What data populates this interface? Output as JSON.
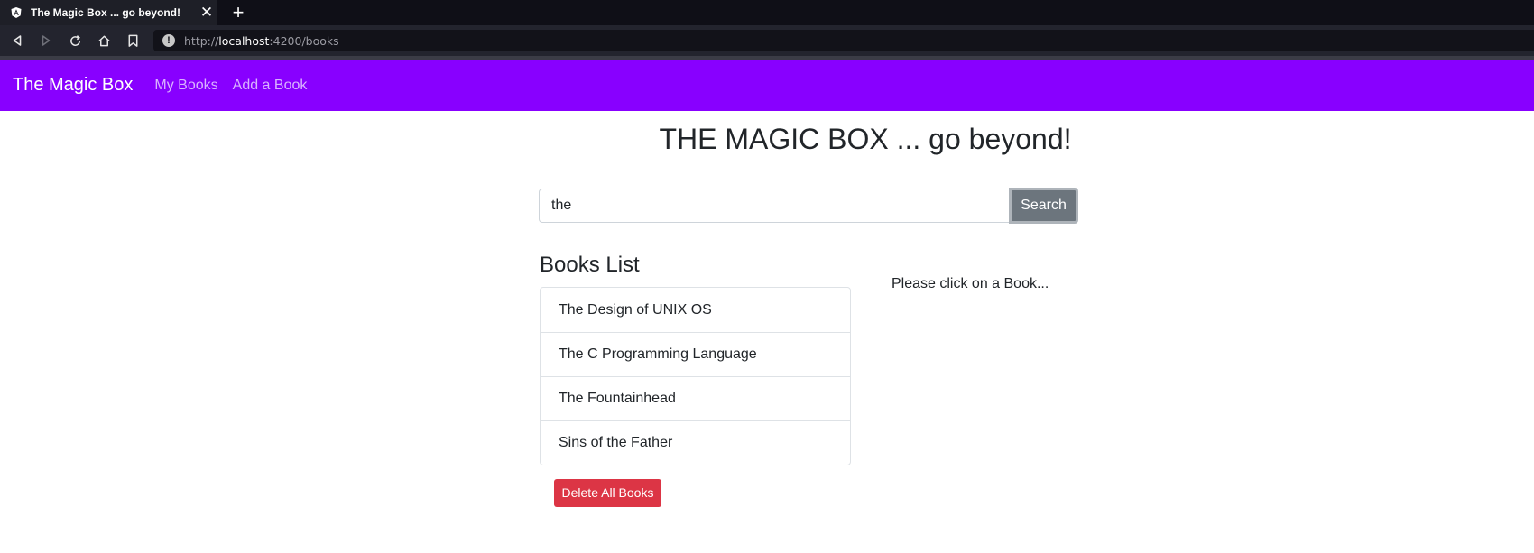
{
  "browser": {
    "tab_title": "The Magic Box ... go beyond!",
    "close_glyph": "✕",
    "new_tab_glyph": "+",
    "url_scheme": "http://",
    "url_host": "localhost",
    "url_path": ":4200/books",
    "info_glyph": "!",
    "icons": [
      "angular-favicon-icon",
      "back-icon",
      "forward-icon",
      "reload-icon",
      "home-icon",
      "bookmark-icon",
      "site-info-icon"
    ]
  },
  "app_nav": {
    "brand": "The Magic Box",
    "links": [
      "My Books",
      "Add a Book"
    ],
    "background": "#8800ff"
  },
  "main": {
    "heading": "THE MAGIC BOX ... go beyond!",
    "search": {
      "value": "the",
      "button_label": "Search"
    },
    "books_list": {
      "heading": "Books List",
      "items": [
        "The Design of UNIX OS",
        "The C Programming Language",
        "The Fountainhead",
        "Sins of the Father"
      ]
    },
    "detail_hint": "Please click on a Book...",
    "delete_all_label": "Delete All Books"
  },
  "colors": {
    "search_button": "#6c757d",
    "delete_button": "#dc3545"
  }
}
